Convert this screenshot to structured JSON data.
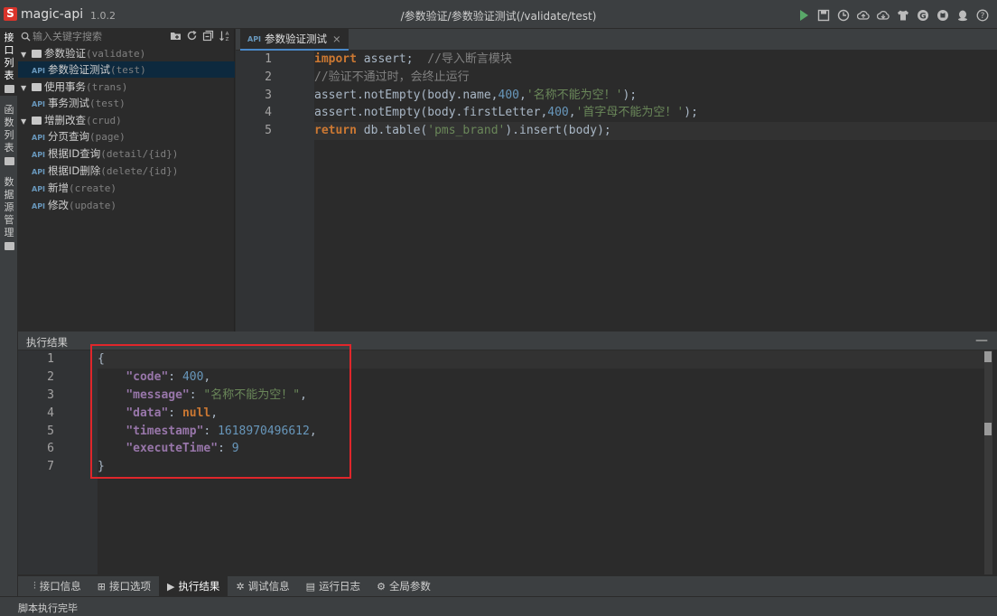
{
  "app": {
    "logo_letter": "S",
    "name": "magic-api",
    "version": "1.0.2",
    "window_path": "/参数验证/参数验证测试(/validate/test)"
  },
  "toolbar_icons": [
    "run-icon",
    "save-icon",
    "history-icon",
    "upload-icon",
    "download-icon",
    "theme-icon",
    "gitee-icon",
    "github-icon",
    "qq-icon",
    "help-icon"
  ],
  "side_tabs": [
    {
      "chars": [
        "接",
        "口",
        "列",
        "表"
      ]
    },
    {
      "chars": [
        "函",
        "数",
        "列",
        "表"
      ]
    },
    {
      "chars": [
        "数",
        "据",
        "源",
        "管",
        "理"
      ]
    }
  ],
  "search": {
    "placeholder": "输入关键字搜索"
  },
  "tree": [
    {
      "type": "group",
      "label": "参数验证",
      "path": "(validate)"
    },
    {
      "type": "api",
      "label": "参数验证测试",
      "path": "(test)",
      "selected": true
    },
    {
      "type": "group",
      "label": "使用事务",
      "path": "(trans)"
    },
    {
      "type": "api",
      "label": "事务测试",
      "path": "(test)"
    },
    {
      "type": "group",
      "label": "增删改查",
      "path": "(crud)"
    },
    {
      "type": "api",
      "label": "分页查询",
      "path": "(page)"
    },
    {
      "type": "api",
      "label": "根据ID查询",
      "path": "(detail/{id})"
    },
    {
      "type": "api",
      "label": "根据ID删除",
      "path": "(delete/{id})"
    },
    {
      "type": "api",
      "label": "新增",
      "path": "(create)"
    },
    {
      "type": "api",
      "label": "修改",
      "path": "(update)"
    }
  ],
  "api_badge": "API",
  "editor_tab": {
    "label": "参数验证测试",
    "close": "×"
  },
  "code_lines": [
    [
      "1",
      "import assert;  //导入断言模块"
    ],
    [
      "2",
      "//验证不通过时，会终止运行"
    ],
    [
      "3",
      "assert.notEmpty(body.name,400,'名称不能为空！');"
    ],
    [
      "4",
      "assert.notEmpty(body.firstLetter,400,'首字母不能为空！');"
    ],
    [
      "5",
      "return db.table('pms_brand').insert(body);"
    ]
  ],
  "result_panel": {
    "title": "执行结果",
    "minimize": "—"
  },
  "result_lines": [
    "1",
    "2",
    "3",
    "4",
    "5",
    "6",
    "7"
  ],
  "result_json": {
    "code": "400",
    "message": "\"名称不能为空！\"",
    "data": "null",
    "timestamp": "1618970496612",
    "executeTime": "9"
  },
  "bottom_tabs": [
    {
      "icon": "info-icon",
      "label": "接口信息"
    },
    {
      "icon": "options-icon",
      "label": "接口选项"
    },
    {
      "icon": "play-icon",
      "label": "执行结果",
      "active": true
    },
    {
      "icon": "bug-icon",
      "label": "调试信息"
    },
    {
      "icon": "log-icon",
      "label": "运行日志"
    },
    {
      "icon": "gear-icon",
      "label": "全局参数"
    }
  ],
  "status": {
    "text": "脚本执行完毕"
  },
  "colors": {
    "accent": "#4a88c7",
    "highlight_box": "#e0262b",
    "run_green": "#59a869",
    "logo_red": "#d9342b"
  }
}
